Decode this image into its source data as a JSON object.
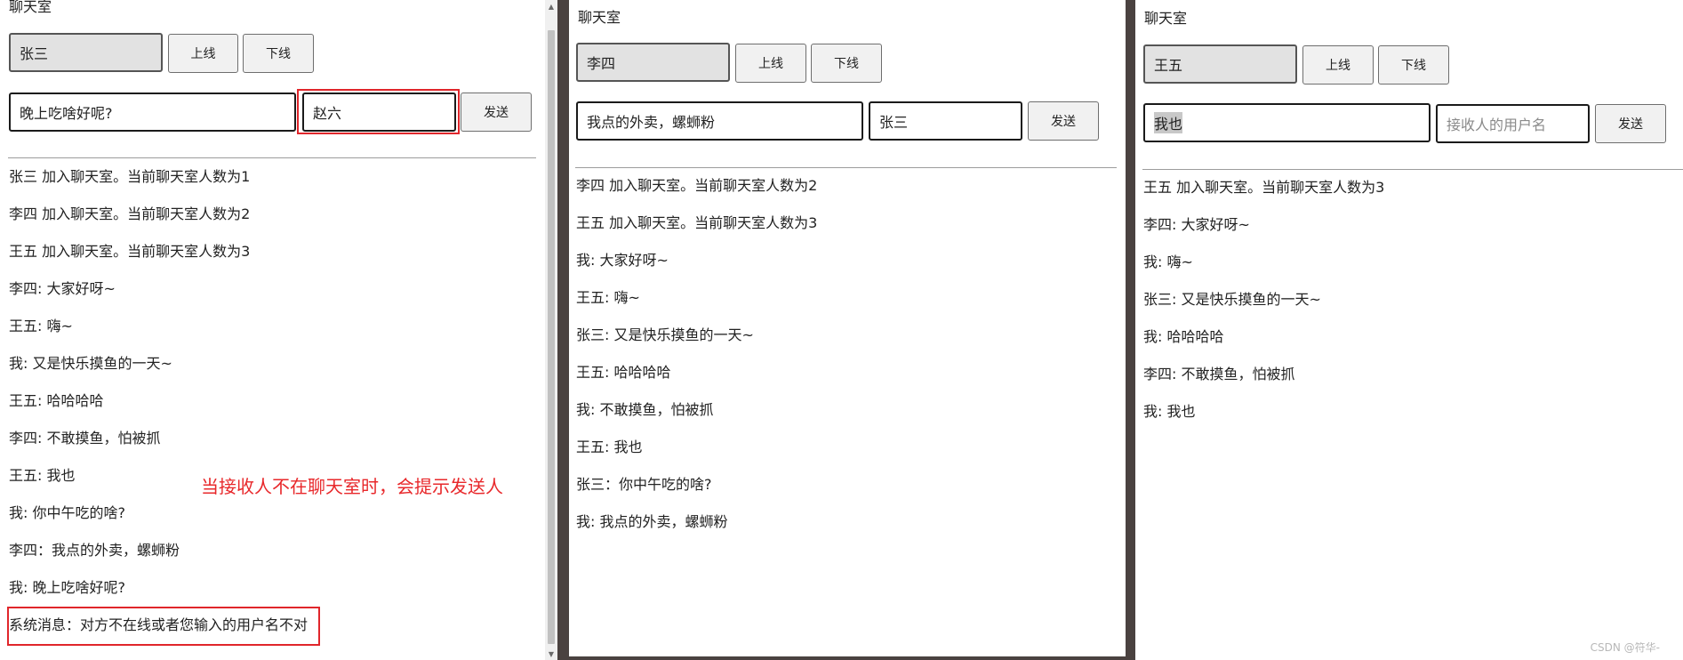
{
  "panels": [
    {
      "title": "聊天室",
      "username": "张三",
      "online_label": "上线",
      "offline_label": "下线",
      "message_value": "晚上吃啥好呢?",
      "recipient_value": "赵六",
      "recipient_placeholder": "",
      "send_label": "发送",
      "messages": [
        "张三 加入聊天室。当前聊天室人数为1",
        "李四 加入聊天室。当前聊天室人数为2",
        "王五 加入聊天室。当前聊天室人数为3",
        "李四: 大家好呀~",
        "王五: 嗨~",
        "我: 又是快乐摸鱼的一天~",
        "王五: 哈哈哈哈",
        "李四: 不敢摸鱼，怕被抓",
        "王五: 我也",
        "我: 你中午吃的啥?",
        "李四：我点的外卖，螺蛳粉",
        "我: 晚上吃啥好呢?",
        "系统消息：对方不在线或者您输入的用户名不对"
      ]
    },
    {
      "title": "聊天室",
      "username": "李四",
      "online_label": "上线",
      "offline_label": "下线",
      "message_value": "我点的外卖，螺蛳粉",
      "recipient_value": "张三",
      "recipient_placeholder": "",
      "send_label": "发送",
      "messages": [
        "李四 加入聊天室。当前聊天室人数为2",
        "王五 加入聊天室。当前聊天室人数为3",
        "我: 大家好呀~",
        "王五: 嗨~",
        "张三: 又是快乐摸鱼的一天~",
        "王五: 哈哈哈哈",
        "我: 不敢摸鱼，怕被抓",
        "王五: 我也",
        "张三：你中午吃的啥?",
        "我: 我点的外卖，螺蛳粉"
      ]
    },
    {
      "title": "聊天室",
      "username": "王五",
      "online_label": "上线",
      "offline_label": "下线",
      "message_value": "我也",
      "recipient_value": "",
      "recipient_placeholder": "接收人的用户名",
      "send_label": "发送",
      "messages": [
        "王五 加入聊天室。当前聊天室人数为3",
        "李四: 大家好呀~",
        "我: 嗨~",
        "张三: 又是快乐摸鱼的一天~",
        "我: 哈哈哈哈",
        "李四: 不敢摸鱼，怕被抓",
        "我: 我也"
      ]
    }
  ],
  "annotation": "当接收人不在聊天室时，会提示发送人",
  "watermark": "CSDN @符华-",
  "colors": {
    "highlight": "#e0262b",
    "panel_bg": "#ffffff",
    "backdrop": "#4a4240"
  }
}
